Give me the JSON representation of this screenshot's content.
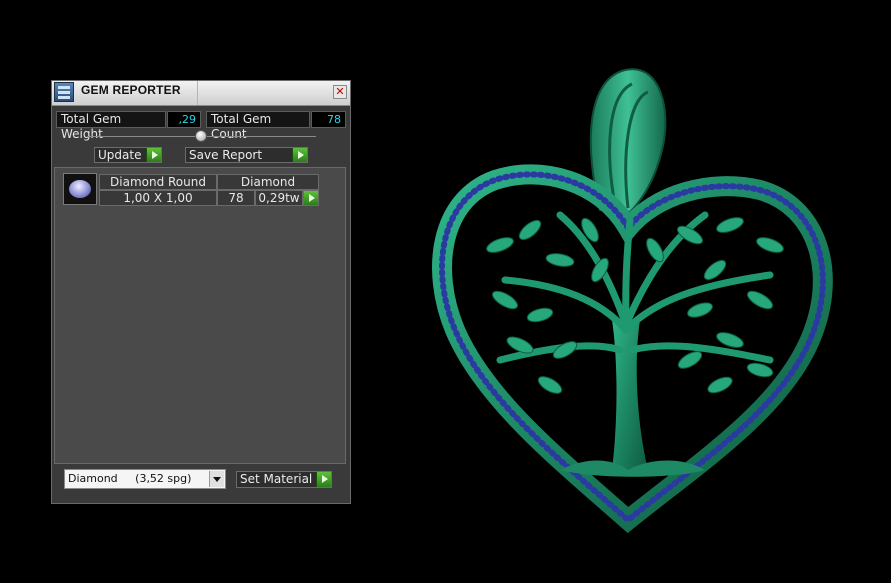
{
  "panel": {
    "title": "GEM REPORTER",
    "total_weight_label": "Total Gem Weight",
    "total_weight_value": ",29",
    "total_count_label": "Total Gem Count",
    "total_count_value": "78",
    "update_label": "Update",
    "save_report_label": "Save Report",
    "gems": [
      {
        "shape": "Diamond Round",
        "material": "Diamond",
        "size": "1,00 X 1,00",
        "count": "78",
        "weight": "0,29tw"
      }
    ],
    "material_select_value": "Diamond     (3,52 spg)",
    "set_material_label": "Set Material"
  },
  "colors": {
    "metal": "#1f8a66",
    "gem": "#2a3aa0",
    "value_text": "#2cd4e6",
    "button_green": "#4ab02e"
  }
}
